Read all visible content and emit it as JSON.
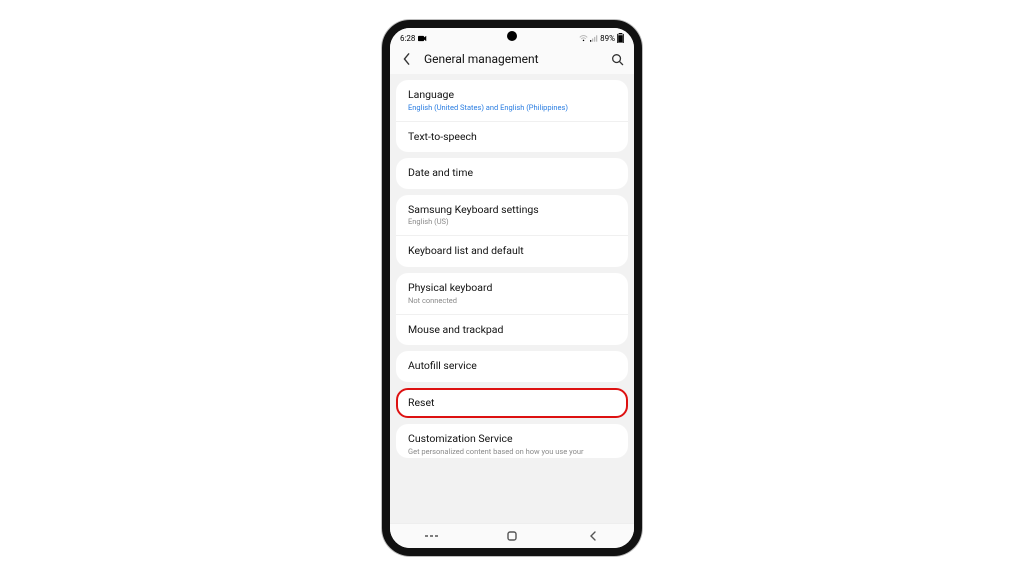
{
  "status": {
    "time": "6:28",
    "battery": "89%"
  },
  "header": {
    "title": "General management"
  },
  "groups": [
    {
      "items": [
        {
          "label": "Language",
          "subtitle": "English (United States) and English (Philippines)"
        },
        {
          "label": "Text-to-speech"
        }
      ]
    },
    {
      "items": [
        {
          "label": "Date and time"
        }
      ]
    },
    {
      "items": [
        {
          "label": "Samsung Keyboard settings",
          "subtitle": "English (US)"
        },
        {
          "label": "Keyboard list and default"
        }
      ]
    },
    {
      "items": [
        {
          "label": "Physical keyboard",
          "subtitle": "Not connected"
        },
        {
          "label": "Mouse and trackpad"
        }
      ]
    },
    {
      "items": [
        {
          "label": "Autofill service"
        }
      ]
    },
    {
      "items": [
        {
          "label": "Reset",
          "highlighted": true
        }
      ]
    },
    {
      "items": [
        {
          "label": "Customization Service",
          "subtitle": "Get personalized content based on how you use your"
        }
      ]
    }
  ],
  "colors": {
    "link": "#2a7de1",
    "highlight": "#d11"
  }
}
